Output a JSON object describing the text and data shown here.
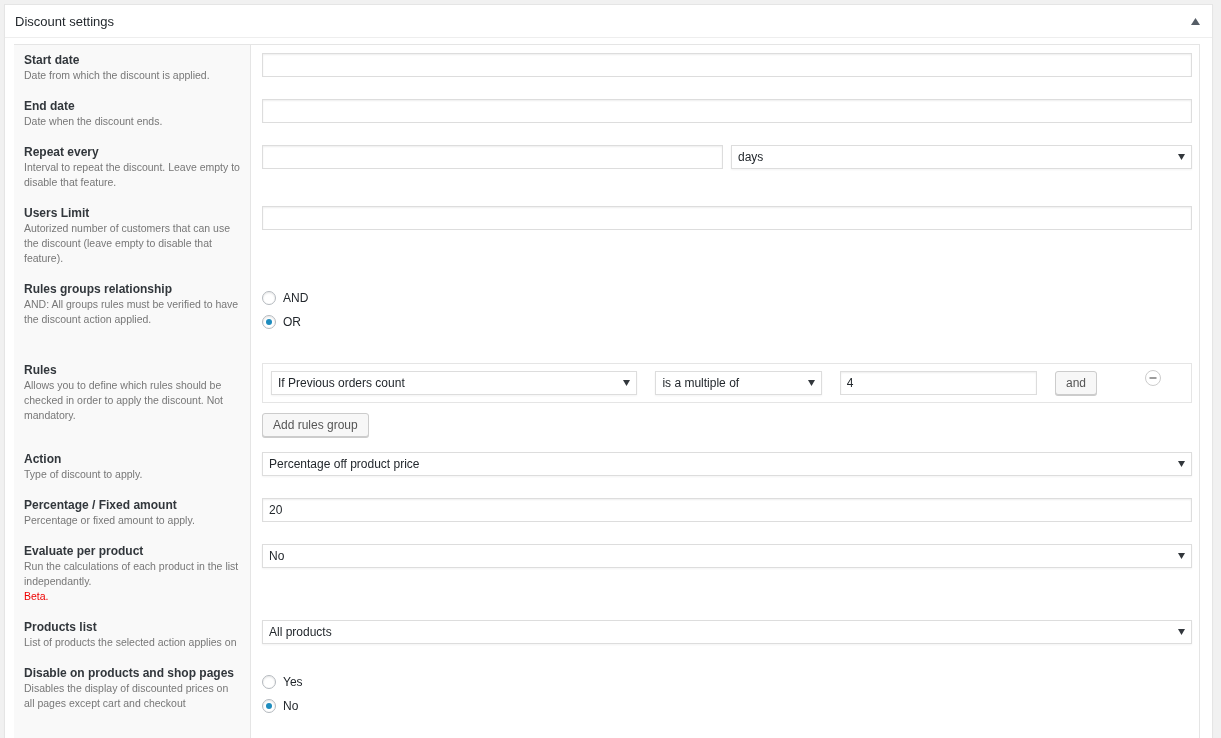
{
  "panel": {
    "title": "Discount settings",
    "expanded": true
  },
  "rows": [
    {
      "kind": "text",
      "label": "Start date",
      "description": "Date from which the discount is applied."
    },
    {
      "kind": "text",
      "label": "End date",
      "description": "Date when the discount ends."
    },
    {
      "kind": "text_select",
      "label": "Repeat every",
      "description": "Interval to repeat the discount. Leave empty to disable that feature.",
      "select_value": "days"
    },
    {
      "kind": "text",
      "label": "Users Limit",
      "description": "Autorized number of customers that can use the discount (leave empty to disable that feature)."
    },
    {
      "kind": "radio",
      "label": "Rules groups relationship",
      "description": "AND: All groups rules must be verified to have the discount action applied.",
      "options": [
        {
          "label": "AND",
          "selected": false
        },
        {
          "label": "OR",
          "selected": true
        }
      ]
    },
    {
      "kind": "rules",
      "label": "Rules",
      "description": "Allows you to define which rules should be checked in order to apply the discount. Not mandatory.",
      "groups": [
        {
          "conditions": [
            {
              "field": "If Previous orders count",
              "operator": "is a multiple of",
              "value": "4",
              "button": "and"
            }
          ]
        }
      ],
      "add_button": "Add rules group"
    },
    {
      "kind": "select",
      "label": "Action",
      "description": "Type of discount to apply.",
      "value": "Percentage off product price"
    },
    {
      "kind": "text",
      "label": "Percentage / Fixed amount",
      "description": "Percentage or fixed amount to apply.",
      "value": "20"
    },
    {
      "kind": "select",
      "label": "Evaluate per product",
      "description": "Run the calculations of each product in the list independantly.",
      "note": "Beta.",
      "value": "No"
    },
    {
      "kind": "select",
      "label": "Products list",
      "description": "List of products the selected action applies on",
      "value": "All products"
    },
    {
      "kind": "radio",
      "label": "Disable on products and shop pages",
      "description": "Disables the display of discounted prices on all pages except cart and checkout",
      "options": [
        {
          "label": "Yes",
          "selected": false
        },
        {
          "label": "No",
          "selected": true
        }
      ]
    }
  ]
}
